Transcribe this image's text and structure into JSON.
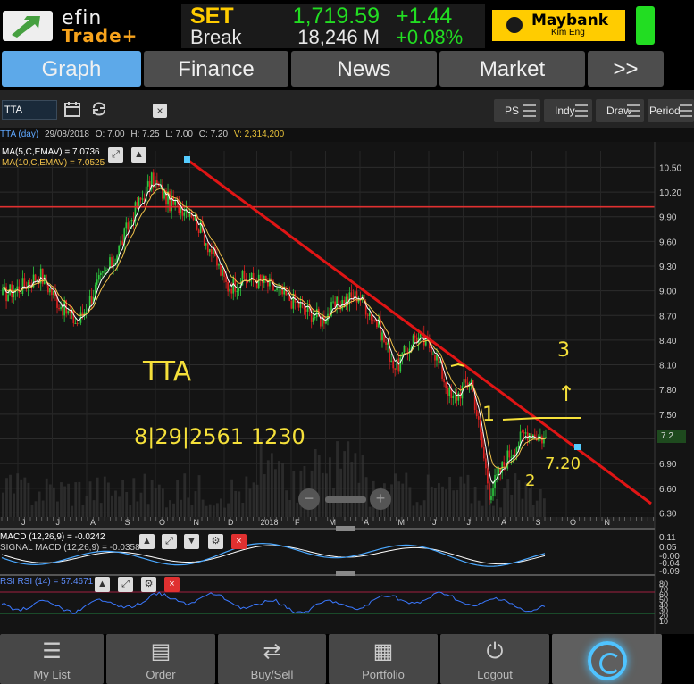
{
  "app": {
    "logo_line1": "efin",
    "logo_line2": "Trade+"
  },
  "ticker": {
    "index_name": "SET",
    "index_value": "1,719.59",
    "change": "+1.44",
    "status": "Break",
    "volume": "18,246 M",
    "change_pct": "+0.08%"
  },
  "broker": {
    "name": "Maybank",
    "sub": "Kim Eng"
  },
  "tabs": [
    {
      "label": "Graph",
      "active": true
    },
    {
      "label": "Finance",
      "active": false
    },
    {
      "label": "News",
      "active": false
    },
    {
      "label": "Market",
      "active": false
    },
    {
      "label": ">>",
      "active": false
    }
  ],
  "toolbar": {
    "symbol_value": "TTA",
    "close_label": "×",
    "buttons": [
      {
        "label": "PS"
      },
      {
        "label": "Indy"
      },
      {
        "label": "Draw"
      },
      {
        "label": "Period"
      }
    ]
  },
  "info": {
    "symbol_period": "TTA (day)",
    "date": "29/08/2018",
    "open_label": "O:",
    "open": "7.00",
    "high_label": "H:",
    "high": "7.25",
    "low_label": "L:",
    "low": "7.00",
    "close_label": "C:",
    "close": "7.20",
    "volume_label": "V:",
    "volume": "2,314,200"
  },
  "chart": {
    "ma_legend": [
      "MA(5,C,EMAV) = 7.0736",
      "MA(10,C,EMAV) = 7.0525"
    ],
    "price_tag": "7.2",
    "macd_legend": [
      "MACD (12,26,9) = -0.0242",
      "SIGNAL MACD (12,26,9) = -0.0358"
    ],
    "rsi_legend": "RSI RSI (14) = 57.4671",
    "annotations": {
      "title": "TTA",
      "datetime": "8|29|2561 1230",
      "label_1": "1",
      "label_2": "2",
      "label_3": "3",
      "arrow": "↑",
      "price_note": "7.20"
    },
    "colors": {
      "up": "#2ecc40",
      "down": "#e02020",
      "ma5": "#ffffff",
      "ma10": "#f1c24b",
      "trendline": "#e01515",
      "resistance": "#e03030",
      "annotation": "#f5e03a",
      "macd": "#4aa8ff",
      "signal": "#ffffff",
      "rsi": "#3a78ff"
    }
  },
  "chart_data": {
    "type": "candlestick",
    "y_ticks": [
      "10.50",
      "10.20",
      "9.90",
      "9.60",
      "9.30",
      "9.00",
      "8.70",
      "8.40",
      "8.10",
      "7.80",
      "7.50",
      "7.20",
      "6.90",
      "6.60",
      "6.30"
    ],
    "ylim": [
      6.25,
      10.7
    ],
    "x_ticks": [
      "J",
      "J",
      "A",
      "S",
      "O",
      "N",
      "D",
      "2018",
      "F",
      "M",
      "A",
      "M",
      "J",
      "J",
      "A",
      "S",
      "O",
      "N"
    ],
    "macd_ticks": [
      "0.11",
      "0.05",
      "-0.00",
      "-0.04",
      "-0.09"
    ],
    "rsi_ticks": [
      "80",
      "70",
      "60",
      "50",
      "40",
      "30",
      "20",
      "10"
    ],
    "resistance_level": 10.02,
    "trendline": {
      "from_date": "2017-10-25",
      "from_price": 10.55,
      "to_date": "2018-08-29",
      "to_price": 7.07
    },
    "close_path": [
      {
        "m": "2017-06",
        "c": 8.95
      },
      {
        "m": "2017-06b",
        "c": 9.05
      },
      {
        "m": "2017-07",
        "c": 9.2
      },
      {
        "m": "2017-07b",
        "c": 8.85
      },
      {
        "m": "2017-08",
        "c": 8.6
      },
      {
        "m": "2017-08b",
        "c": 9.05
      },
      {
        "m": "2017-09",
        "c": 9.4
      },
      {
        "m": "2017-09b",
        "c": 9.95
      },
      {
        "m": "2017-10",
        "c": 10.35
      },
      {
        "m": "2017-10b",
        "c": 10.05
      },
      {
        "m": "2017-11",
        "c": 10.0
      },
      {
        "m": "2017-11b",
        "c": 9.55
      },
      {
        "m": "2017-12",
        "c": 9.05
      },
      {
        "m": "2017-12b",
        "c": 9.15
      },
      {
        "m": "2018-01",
        "c": 9.1
      },
      {
        "m": "2018-01b",
        "c": 8.95
      },
      {
        "m": "2018-02",
        "c": 8.8
      },
      {
        "m": "2018-02b",
        "c": 8.65
      },
      {
        "m": "2018-03",
        "c": 8.85
      },
      {
        "m": "2018-03b",
        "c": 8.95
      },
      {
        "m": "2018-04",
        "c": 8.6
      },
      {
        "m": "2018-04b",
        "c": 8.05
      },
      {
        "m": "2018-05",
        "c": 8.45
      },
      {
        "m": "2018-05b",
        "c": 8.3
      },
      {
        "m": "2018-06",
        "c": 7.65
      },
      {
        "m": "2018-06b",
        "c": 7.95
      },
      {
        "m": "2018-07",
        "c": 6.55
      },
      {
        "m": "2018-07b",
        "c": 7.0
      },
      {
        "m": "2018-08",
        "c": 7.3
      },
      {
        "m": "2018-08b",
        "c": 7.2
      }
    ]
  }
}
